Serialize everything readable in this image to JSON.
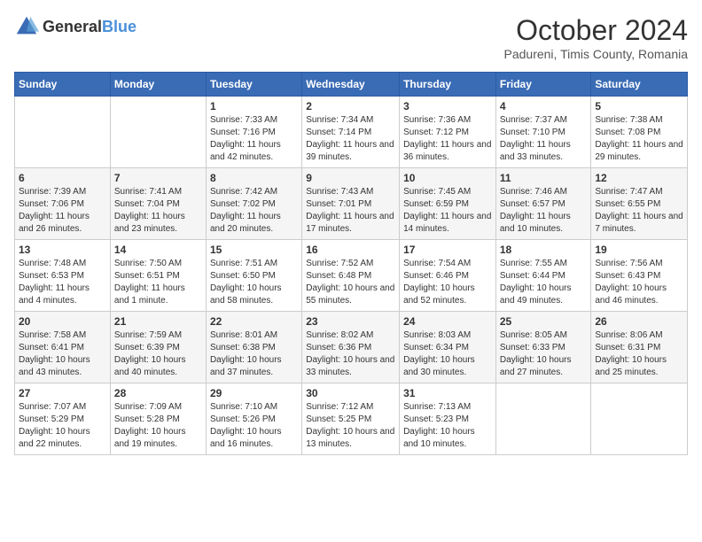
{
  "header": {
    "logo_general": "General",
    "logo_blue": "Blue",
    "title": "October 2024",
    "subtitle": "Padureni, Timis County, Romania"
  },
  "days_of_week": [
    "Sunday",
    "Monday",
    "Tuesday",
    "Wednesday",
    "Thursday",
    "Friday",
    "Saturday"
  ],
  "weeks": [
    [
      {
        "day": "",
        "info": ""
      },
      {
        "day": "",
        "info": ""
      },
      {
        "day": "1",
        "info": "Sunrise: 7:33 AM\nSunset: 7:16 PM\nDaylight: 11 hours and 42 minutes."
      },
      {
        "day": "2",
        "info": "Sunrise: 7:34 AM\nSunset: 7:14 PM\nDaylight: 11 hours and 39 minutes."
      },
      {
        "day": "3",
        "info": "Sunrise: 7:36 AM\nSunset: 7:12 PM\nDaylight: 11 hours and 36 minutes."
      },
      {
        "day": "4",
        "info": "Sunrise: 7:37 AM\nSunset: 7:10 PM\nDaylight: 11 hours and 33 minutes."
      },
      {
        "day": "5",
        "info": "Sunrise: 7:38 AM\nSunset: 7:08 PM\nDaylight: 11 hours and 29 minutes."
      }
    ],
    [
      {
        "day": "6",
        "info": "Sunrise: 7:39 AM\nSunset: 7:06 PM\nDaylight: 11 hours and 26 minutes."
      },
      {
        "day": "7",
        "info": "Sunrise: 7:41 AM\nSunset: 7:04 PM\nDaylight: 11 hours and 23 minutes."
      },
      {
        "day": "8",
        "info": "Sunrise: 7:42 AM\nSunset: 7:02 PM\nDaylight: 11 hours and 20 minutes."
      },
      {
        "day": "9",
        "info": "Sunrise: 7:43 AM\nSunset: 7:01 PM\nDaylight: 11 hours and 17 minutes."
      },
      {
        "day": "10",
        "info": "Sunrise: 7:45 AM\nSunset: 6:59 PM\nDaylight: 11 hours and 14 minutes."
      },
      {
        "day": "11",
        "info": "Sunrise: 7:46 AM\nSunset: 6:57 PM\nDaylight: 11 hours and 10 minutes."
      },
      {
        "day": "12",
        "info": "Sunrise: 7:47 AM\nSunset: 6:55 PM\nDaylight: 11 hours and 7 minutes."
      }
    ],
    [
      {
        "day": "13",
        "info": "Sunrise: 7:48 AM\nSunset: 6:53 PM\nDaylight: 11 hours and 4 minutes."
      },
      {
        "day": "14",
        "info": "Sunrise: 7:50 AM\nSunset: 6:51 PM\nDaylight: 11 hours and 1 minute."
      },
      {
        "day": "15",
        "info": "Sunrise: 7:51 AM\nSunset: 6:50 PM\nDaylight: 10 hours and 58 minutes."
      },
      {
        "day": "16",
        "info": "Sunrise: 7:52 AM\nSunset: 6:48 PM\nDaylight: 10 hours and 55 minutes."
      },
      {
        "day": "17",
        "info": "Sunrise: 7:54 AM\nSunset: 6:46 PM\nDaylight: 10 hours and 52 minutes."
      },
      {
        "day": "18",
        "info": "Sunrise: 7:55 AM\nSunset: 6:44 PM\nDaylight: 10 hours and 49 minutes."
      },
      {
        "day": "19",
        "info": "Sunrise: 7:56 AM\nSunset: 6:43 PM\nDaylight: 10 hours and 46 minutes."
      }
    ],
    [
      {
        "day": "20",
        "info": "Sunrise: 7:58 AM\nSunset: 6:41 PM\nDaylight: 10 hours and 43 minutes."
      },
      {
        "day": "21",
        "info": "Sunrise: 7:59 AM\nSunset: 6:39 PM\nDaylight: 10 hours and 40 minutes."
      },
      {
        "day": "22",
        "info": "Sunrise: 8:01 AM\nSunset: 6:38 PM\nDaylight: 10 hours and 37 minutes."
      },
      {
        "day": "23",
        "info": "Sunrise: 8:02 AM\nSunset: 6:36 PM\nDaylight: 10 hours and 33 minutes."
      },
      {
        "day": "24",
        "info": "Sunrise: 8:03 AM\nSunset: 6:34 PM\nDaylight: 10 hours and 30 minutes."
      },
      {
        "day": "25",
        "info": "Sunrise: 8:05 AM\nSunset: 6:33 PM\nDaylight: 10 hours and 27 minutes."
      },
      {
        "day": "26",
        "info": "Sunrise: 8:06 AM\nSunset: 6:31 PM\nDaylight: 10 hours and 25 minutes."
      }
    ],
    [
      {
        "day": "27",
        "info": "Sunrise: 7:07 AM\nSunset: 5:29 PM\nDaylight: 10 hours and 22 minutes."
      },
      {
        "day": "28",
        "info": "Sunrise: 7:09 AM\nSunset: 5:28 PM\nDaylight: 10 hours and 19 minutes."
      },
      {
        "day": "29",
        "info": "Sunrise: 7:10 AM\nSunset: 5:26 PM\nDaylight: 10 hours and 16 minutes."
      },
      {
        "day": "30",
        "info": "Sunrise: 7:12 AM\nSunset: 5:25 PM\nDaylight: 10 hours and 13 minutes."
      },
      {
        "day": "31",
        "info": "Sunrise: 7:13 AM\nSunset: 5:23 PM\nDaylight: 10 hours and 10 minutes."
      },
      {
        "day": "",
        "info": ""
      },
      {
        "day": "",
        "info": ""
      }
    ]
  ]
}
